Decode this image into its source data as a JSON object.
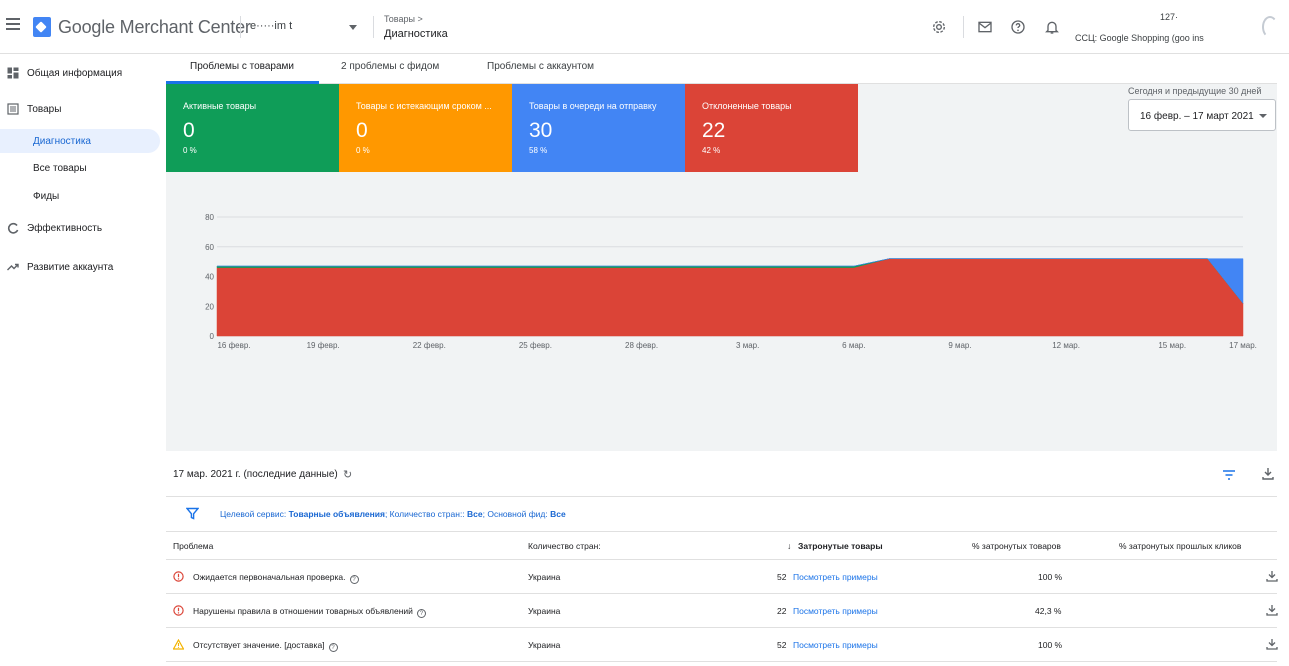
{
  "header": {
    "brand": "Google Merchant Center",
    "account_selector": "e·····im t",
    "breadcrumb_parent": "Товары >",
    "breadcrumb_current": "Диагностика",
    "account_id": "127·",
    "account_name": "ССЦ: Google Shopping (goo                ins"
  },
  "sidebar": {
    "items": [
      {
        "label": "Общая информация",
        "icon": "dashboard-icon"
      },
      {
        "label": "Товары",
        "icon": "list-icon"
      },
      {
        "label": "Диагностика",
        "sub": true,
        "active": true
      },
      {
        "label": "Все товары",
        "sub": true
      },
      {
        "label": "Фиды",
        "sub": true
      },
      {
        "label": "Эффективность",
        "icon": "performance-icon"
      },
      {
        "label": "Развитие аккаунта",
        "icon": "trending-icon"
      }
    ]
  },
  "tabs": [
    {
      "label": "Проблемы с товарами",
      "active": true
    },
    {
      "label": "2 проблемы с фидом"
    },
    {
      "label": "Проблемы с аккаунтом"
    }
  ],
  "cards": [
    {
      "title": "Активные товары",
      "value": "0",
      "pct": "0 %",
      "color": "#0f9d58"
    },
    {
      "title": "Товары с истекающим сроком ...",
      "value": "0",
      "pct": "0 %",
      "color": "#ff9800"
    },
    {
      "title": "Товары в очереди на отправку",
      "value": "30",
      "pct": "58 %",
      "color": "#4285f4"
    },
    {
      "title": "Отклоненные товары",
      "value": "22",
      "pct": "42 %",
      "color": "#db4437"
    }
  ],
  "date_range": {
    "label": "Сегодня и предыдущие 30 дней",
    "value": "16 февр. – 17 март 2021"
  },
  "chart_data": {
    "type": "area",
    "ylim": [
      0,
      80
    ],
    "yticks": [
      "80",
      "60",
      "40",
      "20",
      "0"
    ],
    "xticks": [
      "16 февр.",
      "19 февр.",
      "22 февр.",
      "25 февр.",
      "28 февр.",
      "3 мар.",
      "6 мар.",
      "9 мар.",
      "12 мар.",
      "15 мар.",
      "17 мар."
    ],
    "x": [
      "16 февр.",
      "17 февр.",
      "18 февр.",
      "19 февр.",
      "20 февр.",
      "21 февр.",
      "22 февр.",
      "23 февр.",
      "24 февр.",
      "25 февр.",
      "26 февр.",
      "27 февр.",
      "28 февр.",
      "1 мар.",
      "2 мар.",
      "3 мар.",
      "4 мар.",
      "5 мар.",
      "6 мар.",
      "7 мар.",
      "8 мар.",
      "9 мар.",
      "10 мар.",
      "11 мар.",
      "12 мар.",
      "13 мар.",
      "14 мар.",
      "15 мар.",
      "16 мар.",
      "17 мар."
    ],
    "series": [
      {
        "name": "Отклоненные товары",
        "color": "#db4437",
        "values": [
          46,
          46,
          46,
          46,
          46,
          46,
          46,
          46,
          46,
          46,
          46,
          46,
          46,
          46,
          46,
          46,
          46,
          46,
          46,
          52,
          52,
          52,
          52,
          52,
          52,
          52,
          52,
          52,
          52,
          22
        ]
      },
      {
        "name": "Активные товары",
        "color": "#0f9d58",
        "values": [
          1,
          1,
          1,
          1,
          1,
          1,
          1,
          1,
          1,
          1,
          1,
          1,
          1,
          1,
          1,
          1,
          1,
          1,
          1,
          0,
          0,
          0,
          0,
          0,
          0,
          0,
          0,
          0,
          0,
          0
        ]
      },
      {
        "name": "Товары в очереди на отправку",
        "color": "#4285f4",
        "values": [
          0,
          0,
          0,
          0,
          0,
          0,
          0,
          0,
          0,
          0,
          0,
          0,
          0,
          0,
          0,
          0,
          0,
          0,
          0,
          0,
          0,
          0,
          0,
          0,
          0,
          0,
          0,
          0,
          0,
          30
        ]
      }
    ]
  },
  "table": {
    "updated": "17 мар. 2021 г. (последние данные)",
    "filter_prefix": "Целевой сервис: ",
    "filter_service": "Товарные объявления",
    "filter_mid": "; Количество стран:: ",
    "filter_countries": "Все",
    "filter_feed_label": "; Основной фид: ",
    "filter_feed": "Все",
    "columns": {
      "problem": "Проблема",
      "countries": "Количество стран:",
      "affected": "Затронутые товары",
      "affected_pct": "% затронутых товаров",
      "clicks_pct": "% затронутых прошлых кликов"
    },
    "view_examples": "Посмотреть примеры",
    "rows": [
      {
        "severity": "error",
        "problem": "Ожидается первоначальная проверка.",
        "country": "Украина",
        "count": "52",
        "pct": "100 %"
      },
      {
        "severity": "error",
        "problem": "Нарушены правила в отношении товарных объявлений",
        "country": "Украина",
        "count": "22",
        "pct": "42,3 %"
      },
      {
        "severity": "warning",
        "problem": "Отсутствует значение. [доставка]",
        "country": "Украина",
        "count": "52",
        "pct": "100 %"
      }
    ]
  },
  "colors": {
    "accent": "#1a73e8",
    "error": "#db4437",
    "warning": "#f4b400"
  }
}
